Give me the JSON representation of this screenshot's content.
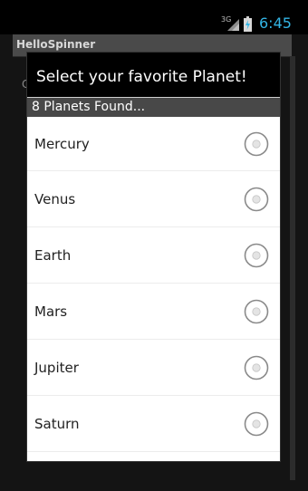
{
  "status_bar": {
    "network": "3G",
    "time": "6:45"
  },
  "app": {
    "title": "HelloSpinner",
    "spinner_glimpse": "C"
  },
  "dialog": {
    "title": "Select your favorite Planet!",
    "count_text": "8 Planets Found...",
    "items": [
      {
        "label": "Mercury",
        "selected": false
      },
      {
        "label": "Venus",
        "selected": false
      },
      {
        "label": "Earth",
        "selected": false
      },
      {
        "label": "Mars",
        "selected": false
      },
      {
        "label": "Jupiter",
        "selected": false
      },
      {
        "label": "Saturn",
        "selected": false
      },
      {
        "label": "",
        "selected": false
      }
    ]
  },
  "colors": {
    "time": "#33b5e5",
    "dialog_header": "#000000",
    "count_bar": "#484848"
  }
}
